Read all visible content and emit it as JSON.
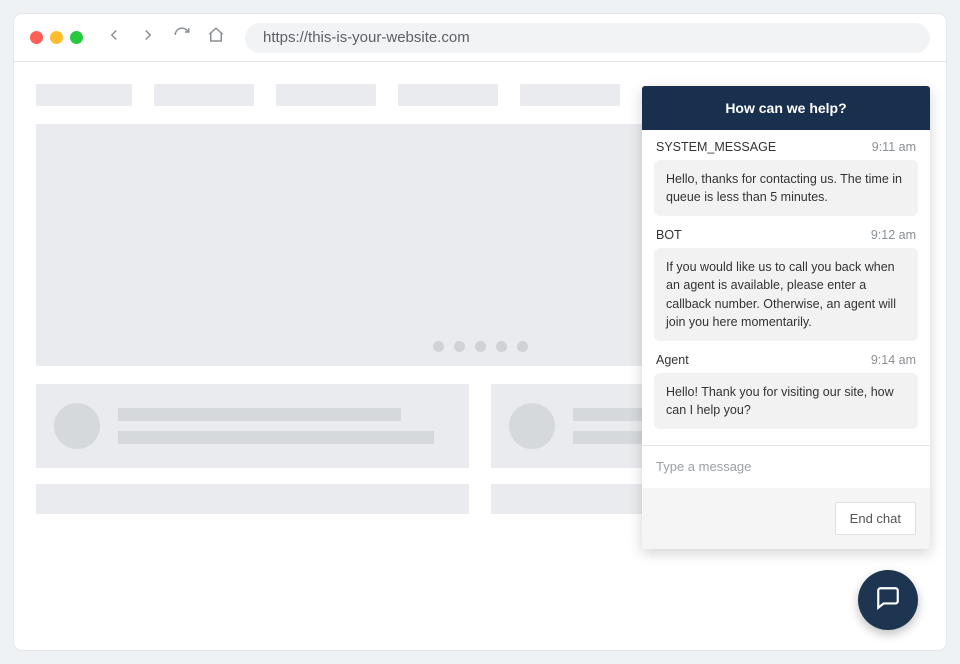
{
  "browser": {
    "url": "https://this-is-your-website.com"
  },
  "chat": {
    "header_title": "How can we help?",
    "input_placeholder": "Type a message",
    "end_button_label": "End chat",
    "messages": [
      {
        "sender": "SYSTEM_MESSAGE",
        "time": "9:11 am",
        "text": "Hello, thanks for contacting us. The time in queue is less than 5 minutes."
      },
      {
        "sender": "BOT",
        "time": "9:12 am",
        "text": "If you would like us to call you back when an agent is available, please enter a callback number. Otherwise, an agent will join you here momentarily."
      },
      {
        "sender": "Agent",
        "time": "9:14 am",
        "text": "Hello! Thank you for visiting our site, how can I help you?"
      }
    ]
  }
}
